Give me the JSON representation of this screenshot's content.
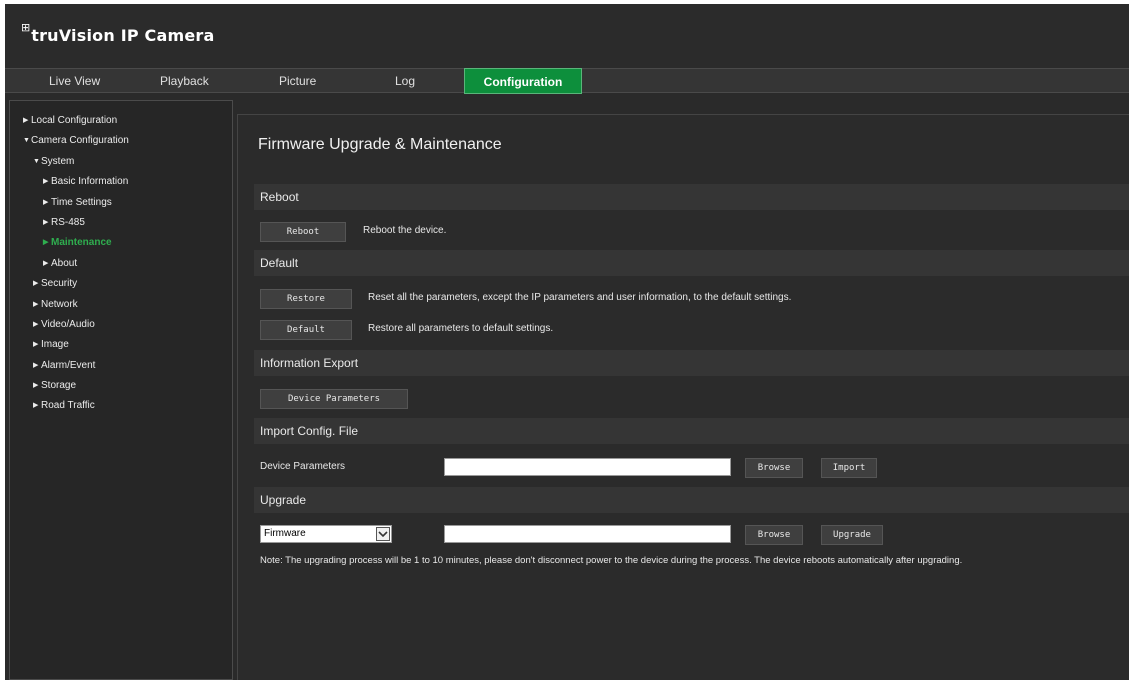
{
  "header": {
    "logo_mark": "⊞",
    "brand": "truVision IP Camera"
  },
  "tabs": [
    {
      "label": "Live View"
    },
    {
      "label": "Playback"
    },
    {
      "label": "Picture"
    },
    {
      "label": "Log"
    },
    {
      "label": "Configuration",
      "active": true
    }
  ],
  "sidebar": {
    "items": [
      {
        "label": "Local Configuration"
      },
      {
        "label": "Camera Configuration"
      },
      {
        "label": "System"
      },
      {
        "label": "Basic Information"
      },
      {
        "label": "Time Settings"
      },
      {
        "label": "RS-485"
      },
      {
        "label": "Maintenance",
        "active": true
      },
      {
        "label": "About"
      },
      {
        "label": "Security"
      },
      {
        "label": "Network"
      },
      {
        "label": "Video/Audio"
      },
      {
        "label": "Image"
      },
      {
        "label": "Alarm/Event"
      },
      {
        "label": "Storage"
      },
      {
        "label": "Road Traffic"
      }
    ]
  },
  "main": {
    "title": "Firmware Upgrade & Maintenance",
    "reboot": {
      "heading": "Reboot",
      "button": "Reboot",
      "description": "Reboot the device."
    },
    "default": {
      "heading": "Default",
      "restore_button": "Restore",
      "restore_description": "Reset all the parameters, except the IP parameters and user information, to the default settings.",
      "default_button": "Default",
      "default_description": "Restore all parameters to default settings."
    },
    "export": {
      "heading": "Information Export",
      "button": "Device Parameters"
    },
    "import": {
      "heading": "Import Config. File",
      "label": "Device Parameters",
      "file_value": "",
      "browse_button": "Browse",
      "import_button": "Import"
    },
    "upgrade": {
      "heading": "Upgrade",
      "select_value": "Firmware",
      "file_value": "",
      "browse_button": "Browse",
      "upgrade_button": "Upgrade",
      "note": "Note: The upgrading process will be 1 to 10 minutes, please don't disconnect power to the device during the process. The device reboots automatically after upgrading."
    }
  },
  "colors": {
    "accent": "#0d8f3c",
    "active_text": "#2fae4f",
    "background": "#2a2a2a"
  }
}
